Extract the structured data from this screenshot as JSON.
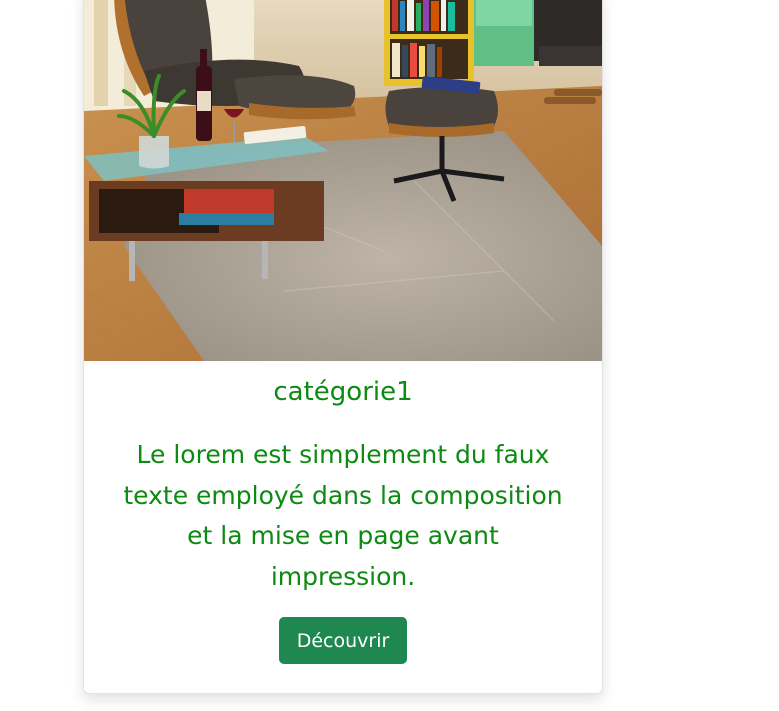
{
  "card": {
    "category": "catégorie1",
    "description": "Le lorem est simplement du faux texte employé dans la composition et la mise en page avant impression.",
    "button_label": "Découvrir"
  },
  "colors": {
    "text_green": "#0d8a12",
    "button_green": "#1f8850",
    "button_text": "#ffffff"
  }
}
